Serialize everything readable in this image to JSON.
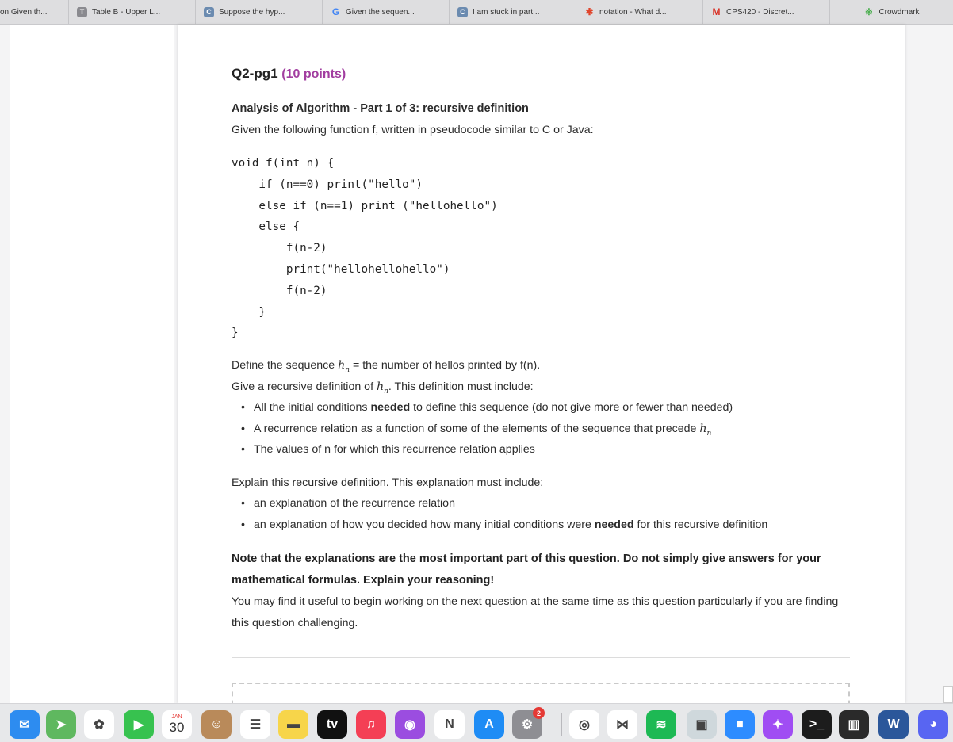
{
  "tabs": [
    {
      "label": "on Given th...",
      "fav": "",
      "color": ""
    },
    {
      "label": "Table B - Upper L...",
      "fav": "T",
      "color": "#8a8a8f"
    },
    {
      "label": "Suppose the hyp...",
      "fav": "C",
      "color": "#6b8bb0"
    },
    {
      "label": "Given the sequen...",
      "fav": "G",
      "color": "#4285f4"
    },
    {
      "label": "I am stuck in part...",
      "fav": "C",
      "color": "#6b8bb0"
    },
    {
      "label": "notation - What d...",
      "fav": "✱",
      "color": "#e0452c"
    },
    {
      "label": "CPS420 - Discret...",
      "fav": "M",
      "color": "#d93025"
    },
    {
      "label": "Crowdmark",
      "fav": "※",
      "color": "#4caf50"
    }
  ],
  "question": {
    "title": "Q2-pg1",
    "points": "(10 points)",
    "heading": "Analysis of Algorithm - Part 1 of 3: recursive definition",
    "intro": "Given the following function f, written in pseudocode similar to C or Java:",
    "code": "void f(int n) {\n    if (n==0) print(\"hello\")\n    else if (n==1) print (\"hellohello\")\n    else {\n        f(n-2)\n        print(\"hellohellohello\")\n        f(n-2)\n    }\n}",
    "define_pre": "Define the sequence ",
    "define_post": " = the number of hellos printed by f(n).",
    "give_pre": "Give a recursive definition of ",
    "give_post": ". This definition must include:",
    "seq_symbol": "h",
    "seq_sub": "n",
    "bullet1_pre": "All the initial conditions ",
    "bullet1_bold": "needed",
    "bullet1_post": " to define this sequence (do not give more or fewer than needed)",
    "bullet2": "A recurrence relation as a function of some of the elements of the sequence that precede ",
    "bullet3": "The values of n for which this recurrence relation applies",
    "explain_intro": "Explain this recursive definition. This explanation must include:",
    "explain_bullet1": "an explanation of the recurrence relation",
    "explain_bullet2_pre": "an explanation of how you decided how many initial conditions were ",
    "explain_bullet2_bold": "needed",
    "explain_bullet2_post": " for this recursive definition",
    "note": "Note that the explanations are the most important part of this question. Do not simply give answers for your mathematical formulas. Explain your reasoning!",
    "tip": "You may find it useful to begin working on the next question at the same time as this question particularly if you are finding this question challenging."
  },
  "dock": [
    {
      "name": "mail-icon",
      "color": "#2d8cf0",
      "glyph": "✉"
    },
    {
      "name": "maps-icon",
      "color": "#5fb85f",
      "glyph": "➤"
    },
    {
      "name": "photos-icon",
      "color": "#ffffff",
      "glyph": "✿"
    },
    {
      "name": "facetime-icon",
      "color": "#37c24f",
      "glyph": "▶"
    },
    {
      "name": "calendar-icon",
      "color": "#ffffff",
      "glyph": "30",
      "month": "JAN"
    },
    {
      "name": "contacts-icon",
      "color": "#b98a5a",
      "glyph": "☺"
    },
    {
      "name": "reminders-icon",
      "color": "#ffffff",
      "glyph": "☰"
    },
    {
      "name": "notes-icon",
      "color": "#f7d54a",
      "glyph": "▬"
    },
    {
      "name": "apple-tv-icon",
      "color": "#111111",
      "glyph": "tv"
    },
    {
      "name": "music-icon",
      "color": "#f43f55",
      "glyph": "♫"
    },
    {
      "name": "podcasts-icon",
      "color": "#9b4de0",
      "glyph": "◉"
    },
    {
      "name": "news-icon",
      "color": "#ffffff",
      "glyph": "N"
    },
    {
      "name": "app-store-icon",
      "color": "#1e8cf5",
      "glyph": "A"
    },
    {
      "name": "system-preferences-icon",
      "color": "#8e8e93",
      "glyph": "⚙",
      "badge": "2"
    },
    {
      "name": "chrome-icon",
      "color": "#ffffff",
      "glyph": "◎"
    },
    {
      "name": "visual-studio-icon",
      "color": "#ffffff",
      "glyph": "⋈"
    },
    {
      "name": "spotify-icon",
      "color": "#1db954",
      "glyph": "≋"
    },
    {
      "name": "preview-icon",
      "color": "#cfd8dc",
      "glyph": "▣"
    },
    {
      "name": "zoom-icon",
      "color": "#2d8cff",
      "glyph": "■"
    },
    {
      "name": "messenger-icon",
      "color": "#a04df3",
      "glyph": "✦"
    },
    {
      "name": "terminal-icon",
      "color": "#1c1c1c",
      "glyph": ">_"
    },
    {
      "name": "piano-icon",
      "color": "#2a2a2a",
      "glyph": "▥"
    },
    {
      "name": "word-icon",
      "color": "#2b579a",
      "glyph": "W"
    },
    {
      "name": "discord-icon",
      "color": "#5865f2",
      "glyph": "◕"
    }
  ]
}
